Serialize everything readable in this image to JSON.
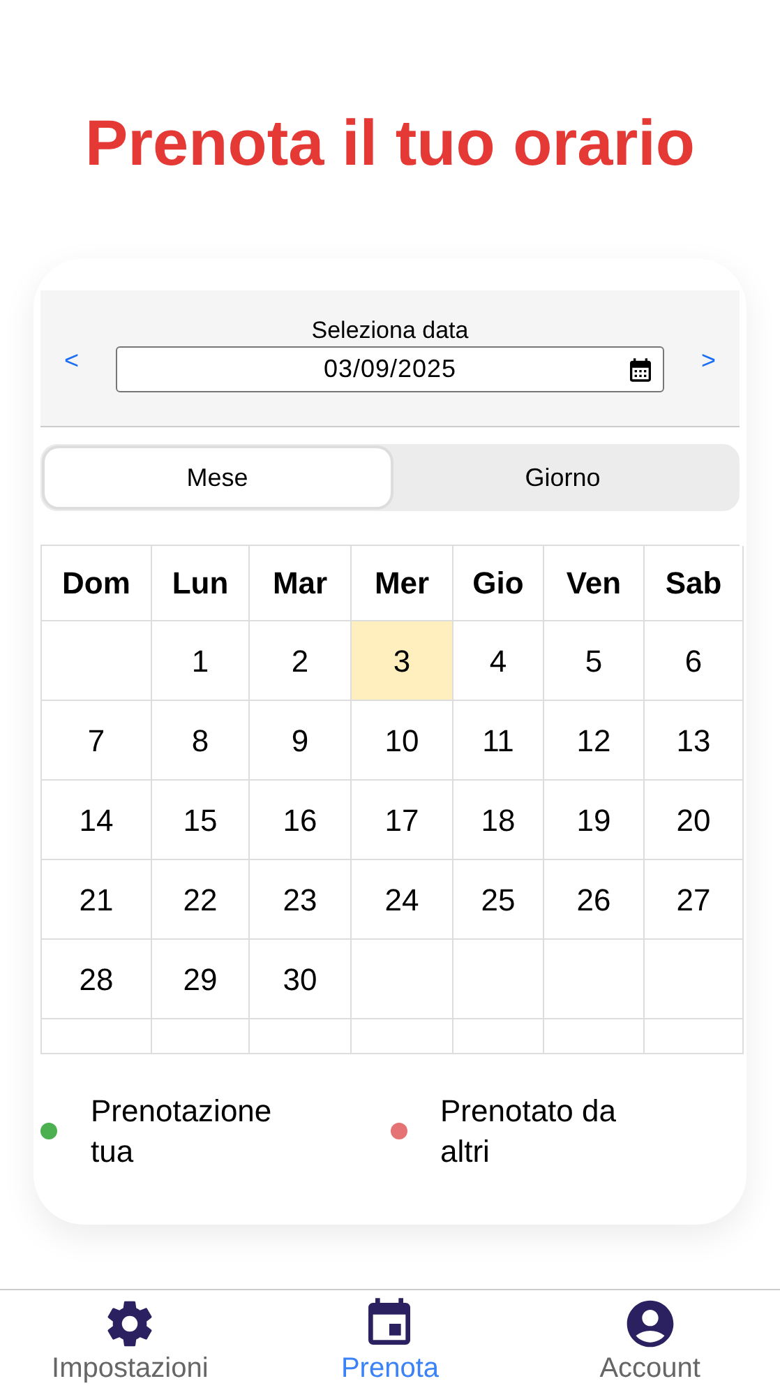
{
  "title": "Prenota il tuo orario",
  "date_picker": {
    "label": "Seleziona data",
    "prev": "<",
    "next": ">",
    "value": "03/09/2025"
  },
  "view_tabs": [
    {
      "label": "Mese",
      "selected": true
    },
    {
      "label": "Giorno",
      "selected": false
    }
  ],
  "calendar": {
    "weekdays": [
      "Dom",
      "Lun",
      "Mar",
      "Mer",
      "Gio",
      "Ven",
      "Sab"
    ],
    "weeks": [
      [
        {
          "kind": "blank"
        },
        {
          "kind": "day",
          "day": "1",
          "selected": false
        },
        {
          "kind": "day",
          "day": "2",
          "selected": false
        },
        {
          "kind": "day",
          "day": "3",
          "selected": true
        },
        {
          "kind": "day",
          "day": "4",
          "selected": false
        },
        {
          "kind": "day",
          "day": "5",
          "selected": false
        },
        {
          "kind": "day",
          "day": "6",
          "selected": false
        }
      ],
      [
        {
          "kind": "day",
          "day": "7",
          "selected": false
        },
        {
          "kind": "day",
          "day": "8",
          "selected": false
        },
        {
          "kind": "day",
          "day": "9",
          "selected": false
        },
        {
          "kind": "day",
          "day": "10",
          "selected": false
        },
        {
          "kind": "day",
          "day": "11",
          "selected": false
        },
        {
          "kind": "day",
          "day": "12",
          "selected": false
        },
        {
          "kind": "day",
          "day": "13",
          "selected": false
        }
      ],
      [
        {
          "kind": "day",
          "day": "14",
          "selected": false
        },
        {
          "kind": "day",
          "day": "15",
          "selected": false
        },
        {
          "kind": "day",
          "day": "16",
          "selected": false
        },
        {
          "kind": "day",
          "day": "17",
          "selected": false
        },
        {
          "kind": "day",
          "day": "18",
          "selected": false
        },
        {
          "kind": "day",
          "day": "19",
          "selected": false
        },
        {
          "kind": "day",
          "day": "20",
          "selected": false
        }
      ],
      [
        {
          "kind": "day",
          "day": "21",
          "selected": false
        },
        {
          "kind": "day",
          "day": "22",
          "selected": false
        },
        {
          "kind": "day",
          "day": "23",
          "selected": false
        },
        {
          "kind": "day",
          "day": "24",
          "selected": false
        },
        {
          "kind": "day",
          "day": "25",
          "selected": false
        },
        {
          "kind": "day",
          "day": "26",
          "selected": false
        },
        {
          "kind": "day",
          "day": "27",
          "selected": false
        }
      ],
      [
        {
          "kind": "day",
          "day": "28",
          "selected": false
        },
        {
          "kind": "day",
          "day": "29",
          "selected": false
        },
        {
          "kind": "day",
          "day": "30",
          "selected": false
        },
        {
          "kind": "blank"
        },
        {
          "kind": "blank"
        },
        {
          "kind": "blank"
        },
        {
          "kind": "blank"
        }
      ],
      [
        {
          "kind": "spacer"
        },
        {
          "kind": "spacer"
        },
        {
          "kind": "spacer"
        },
        {
          "kind": "spacer"
        },
        {
          "kind": "spacer"
        },
        {
          "kind": "spacer"
        },
        {
          "kind": "spacer"
        }
      ]
    ]
  },
  "legend": [
    {
      "label": "Prenotazione tua",
      "color": "#4caf50"
    },
    {
      "label": "Prenotato da altri",
      "color": "#e57373"
    }
  ],
  "bottom_nav": [
    {
      "kind": "gear",
      "label": "Impostazioni",
      "selected": false
    },
    {
      "kind": "calendar",
      "label": "Prenota",
      "selected": true
    },
    {
      "kind": "account",
      "label": "Account",
      "selected": false
    }
  ]
}
